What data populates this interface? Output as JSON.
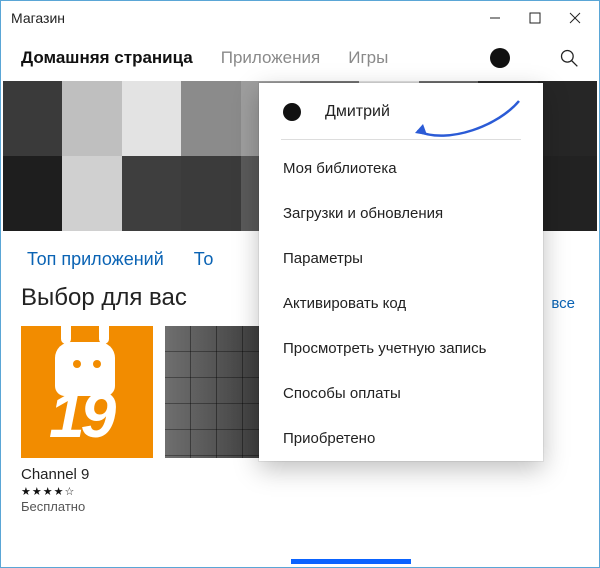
{
  "window": {
    "title": "Магазин"
  },
  "nav": {
    "tabs": [
      {
        "label": "Домашняя страница",
        "active": true
      },
      {
        "label": "Приложения",
        "active": false
      },
      {
        "label": "Игры",
        "active": false
      }
    ]
  },
  "hero": {
    "pixel_colors_row1": [
      "#3a3a3a",
      "#bfbfbf",
      "#e3e3e3",
      "#8b8b8b",
      "#9e9e9e",
      "#747474",
      "#e0e0e0",
      "#6e6e6e",
      "#2f2f2f",
      "#262626"
    ],
    "pixel_colors_row2": [
      "#1e1e1e",
      "#d0d0d0",
      "#3e3e3e",
      "#3b3b3b",
      "#5a5a5a",
      "#c8c8c8",
      "#424242",
      "#4a4a4a",
      "#202020",
      "#222222"
    ]
  },
  "top_links": [
    {
      "label": "Топ приложений"
    },
    {
      "label": "То"
    }
  ],
  "picks": {
    "title": "Выбор для вас",
    "show_all": "все",
    "apps": [
      {
        "name": "Channel 9",
        "stars": "★★★★☆",
        "price": "Бесплатно"
      }
    ]
  },
  "menu": {
    "user_name": "Дмитрий",
    "items": [
      "Моя библиотека",
      "Загрузки и обновления",
      "Параметры",
      "Активировать код",
      "Просмотреть учетную запись",
      "Способы оплаты",
      "Приобретено"
    ]
  }
}
